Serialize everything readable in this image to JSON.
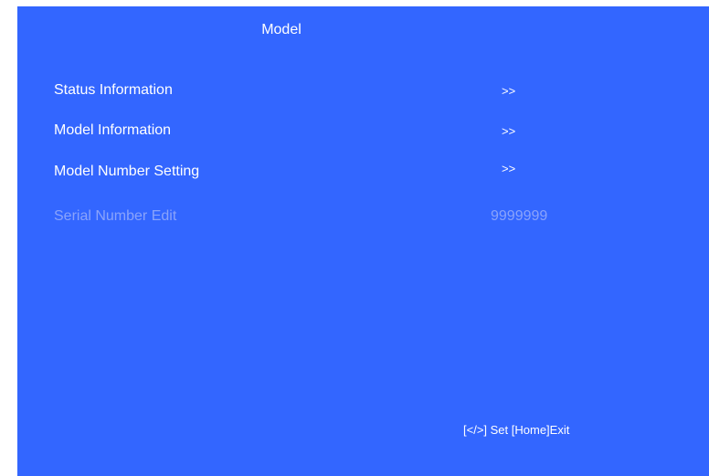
{
  "menu": {
    "title": "Model",
    "items": [
      {
        "label": "Status Information",
        "value": ">>",
        "enabled": true
      },
      {
        "label": "Model Information",
        "value": ">>",
        "enabled": true
      },
      {
        "label": "Model Number Setting",
        "value": ">>",
        "enabled": true
      },
      {
        "label": "Serial Number Edit",
        "value": "9999999",
        "enabled": false
      }
    ]
  },
  "footer": {
    "hint": "[</>] Set [Home]Exit"
  },
  "colors": {
    "background": "#3366ff",
    "text": "#ffffff",
    "disabled_text": "#8aa3fb",
    "page_margin": "#ffffff"
  }
}
